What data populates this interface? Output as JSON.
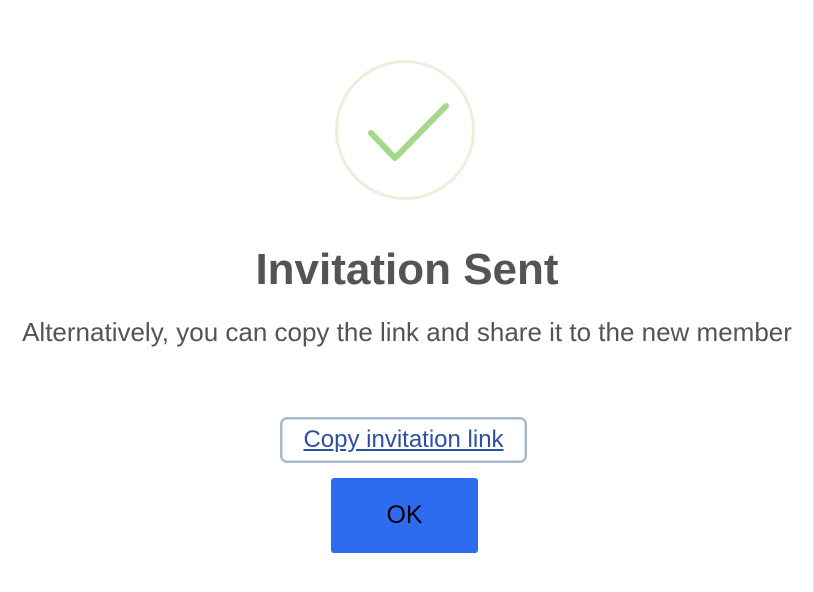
{
  "dialog": {
    "icon": "checkmark-success-icon",
    "title": "Invitation Sent",
    "message": "Alternatively, you can copy the link and share it to the new member",
    "copy_link_label": "Copy invitation link",
    "ok_label": "OK"
  },
  "colors": {
    "success_ring": "#e6f3da",
    "checkmark": "#a5d98a",
    "title_text": "#545454",
    "link_text": "#2c4fa3",
    "ok_button": "#2d6bf0"
  }
}
